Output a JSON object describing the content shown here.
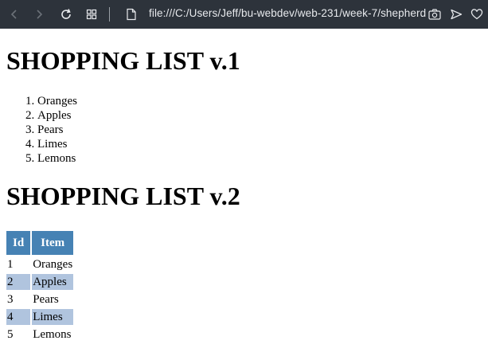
{
  "browser": {
    "url": "file:///C:/Users/Jeff/bu-webdev/web-231/week-7/shepherd"
  },
  "list_v1": {
    "title": "SHOPPING LIST v.1",
    "items": [
      "Oranges",
      "Apples",
      "Pears",
      "Limes",
      "Lemons"
    ]
  },
  "list_v2": {
    "title": "SHOPPING LIST v.2",
    "headers": [
      "Id",
      "Item"
    ],
    "rows": [
      {
        "id": "1",
        "item": "Oranges"
      },
      {
        "id": "2",
        "item": "Apples"
      },
      {
        "id": "3",
        "item": "Pears"
      },
      {
        "id": "4",
        "item": "Limes"
      },
      {
        "id": "5",
        "item": "Lemons"
      }
    ]
  },
  "colors": {
    "header_bg": "#4682b4",
    "alt_row_bg": "#b0c4de",
    "browser_bar_bg": "#2d333b"
  },
  "icons": [
    "back-icon",
    "forward-icon",
    "reload-icon",
    "apps-icon",
    "page-icon",
    "camera-icon",
    "send-icon",
    "heart-icon"
  ]
}
